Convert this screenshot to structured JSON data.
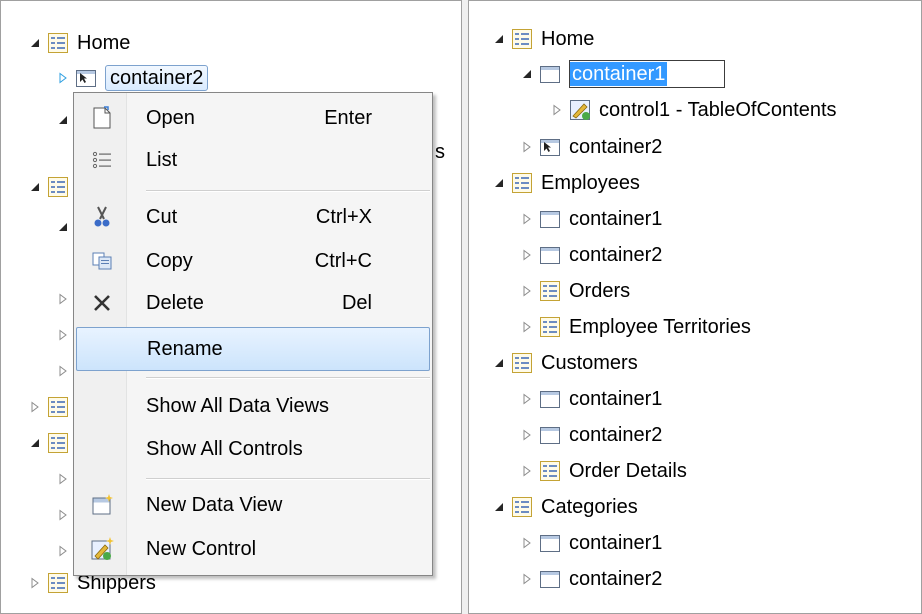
{
  "left": {
    "rows": [
      "Home",
      "container2",
      "s",
      "Shippers"
    ]
  },
  "menu": {
    "items": [
      {
        "label": "Open",
        "shortcut": "Enter",
        "icon": "open-document-icon"
      },
      {
        "label": "List",
        "shortcut": "",
        "icon": "list-icon"
      },
      {
        "label": "Cut",
        "shortcut": "Ctrl+X",
        "icon": "scissors-icon"
      },
      {
        "label": "Copy",
        "shortcut": "Ctrl+C",
        "icon": "copy-icon"
      },
      {
        "label": "Delete",
        "shortcut": "Del",
        "icon": "delete-x-icon"
      },
      {
        "label": "Rename",
        "shortcut": "",
        "icon": ""
      },
      {
        "label": "Show All Data Views",
        "shortcut": "",
        "icon": ""
      },
      {
        "label": "Show All Controls",
        "shortcut": "",
        "icon": ""
      },
      {
        "label": "New Data View",
        "shortcut": "",
        "icon": "new-data-view-icon"
      },
      {
        "label": "New Control",
        "shortcut": "",
        "icon": "new-control-icon"
      }
    ]
  },
  "right": {
    "rows": [
      "Home",
      "container1",
      "control1 - TableOfContents",
      "container2",
      "Employees",
      "container1",
      "container2",
      "Orders",
      "Employee Territories",
      "Customers",
      "container1",
      "container2",
      "Order Details",
      "Categories",
      "container1",
      "container2"
    ]
  },
  "colors": {
    "selection": "#3399ff",
    "highlight_border": "#7da2ce"
  }
}
